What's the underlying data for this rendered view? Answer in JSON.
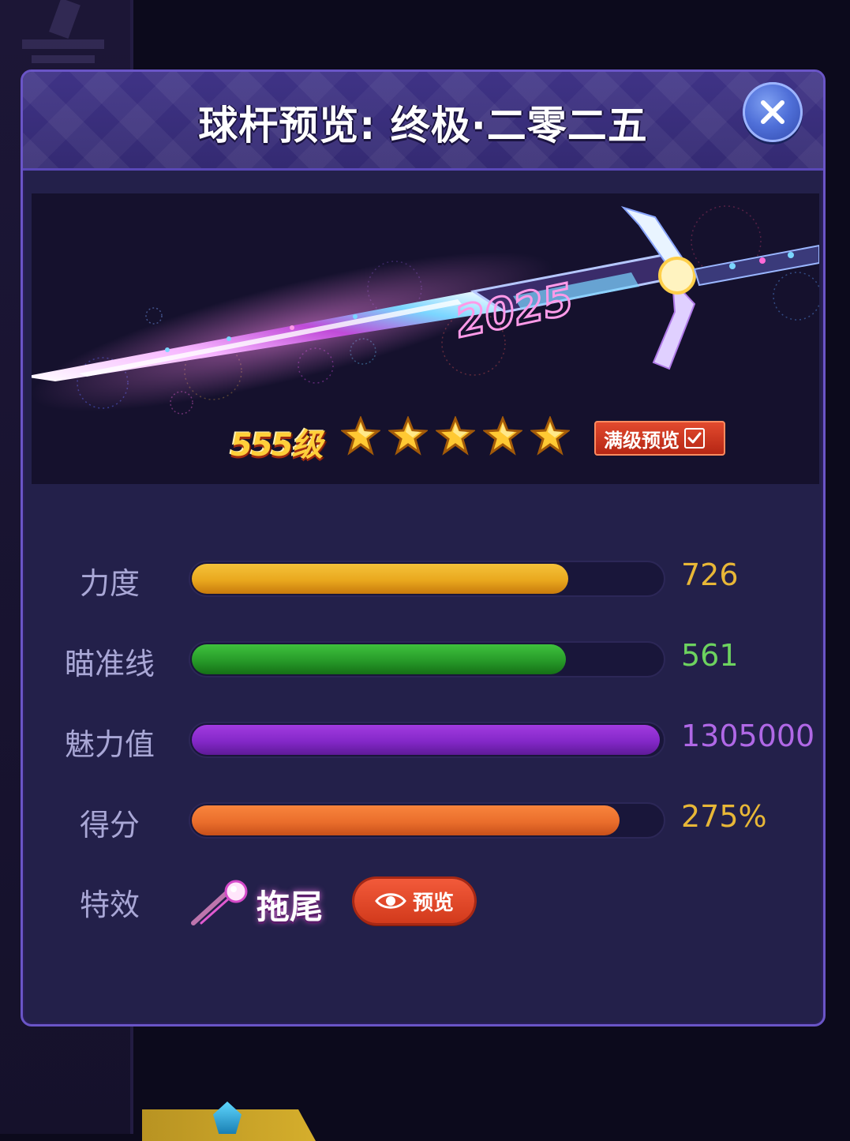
{
  "dialog": {
    "title": "球杆预览:  终极·二零二五",
    "close_icon": "close-icon"
  },
  "preview": {
    "cue_art": "cue-stick-2025",
    "rank_badge": "555级",
    "stars": {
      "filled": 5,
      "total": 5
    },
    "max_level_toggle": {
      "label": "满级预览",
      "checked": true
    }
  },
  "stats": [
    {
      "label": "力度",
      "value": "726",
      "fill": 0.8,
      "color": "#e8b737"
    },
    {
      "label": "瞄准线",
      "value": "561",
      "fill": 0.795,
      "color": "#6dd35f"
    },
    {
      "label": "魅力值",
      "value": "1305000",
      "fill": 0.995,
      "color": "#b068e6"
    },
    {
      "label": "得分",
      "value": "275%",
      "fill": 0.91,
      "color": "#e8b737"
    }
  ],
  "effect": {
    "label": "特效",
    "name": "拖尾",
    "icon": "trail-comet-icon",
    "preview_button": "预览",
    "preview_icon": "eye-icon"
  }
}
